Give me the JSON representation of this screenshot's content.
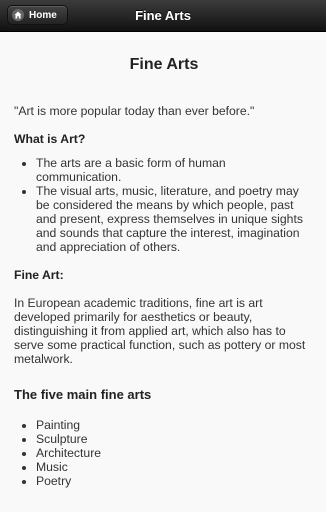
{
  "header": {
    "home_label": "Home",
    "title": "Fine Arts"
  },
  "page": {
    "title": "Fine Arts",
    "quote": "\"Art is more popular today than ever before.\"",
    "sections": {
      "what_is_art": {
        "heading": "What is Art?",
        "items": [
          "The arts are a basic form of human communication.",
          "The visual arts, music, literature, and poetry may be considered the means by which people, past and present, express themselves in unique sights and sounds that capture the interest, imagination and appreciation of others."
        ]
      },
      "fine_art": {
        "heading": "Fine Art:",
        "body": "In European academic traditions, fine art is art developed primarily for aesthetics or beauty, distinguishing it from applied art, which also has to serve some practical function, such as pottery or most metalwork."
      },
      "five_main": {
        "heading": "The five main fine arts",
        "items": [
          "Painting",
          "Sculpture",
          "Architecture",
          "Music",
          "Poetry"
        ]
      }
    }
  }
}
